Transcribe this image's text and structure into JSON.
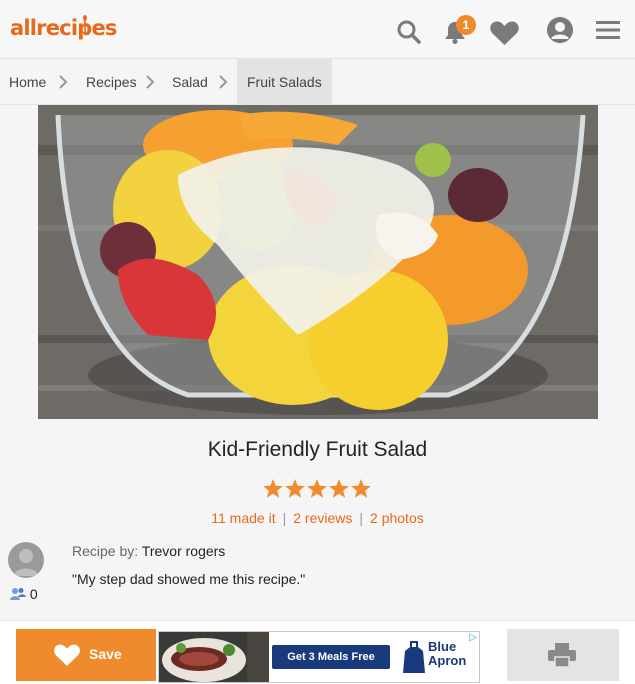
{
  "header": {
    "logo_text": "allrecipes",
    "notification_count": "1",
    "icons": [
      "search-icon",
      "bell-icon",
      "heart-icon",
      "profile-icon",
      "menu-icon"
    ],
    "brand_color": "#e8691c"
  },
  "breadcrumb": {
    "items": [
      {
        "label": "Home"
      },
      {
        "label": "Recipes"
      },
      {
        "label": "Salad"
      },
      {
        "label": "Fruit Salads"
      }
    ]
  },
  "recipe": {
    "title": "Kid-Friendly Fruit Salad",
    "rating": 5,
    "rating_max": 5,
    "made_it": "11 made it",
    "reviews": "2 reviews",
    "photos": "2 photos",
    "separator": "|",
    "author_label": "Recipe by:",
    "author_name": "Trevor rogers",
    "description": "\"My step dad showed me this recipe.\"",
    "followers": "0"
  },
  "footer": {
    "save_label": "Save",
    "ad": {
      "cta": "Get 3 Meals Free",
      "brand_line1": "Blue",
      "brand_line2": "Apron",
      "ad_choices": "▷"
    }
  },
  "colors": {
    "accent": "#f08b2d",
    "star": "#f08b2d",
    "ad_blue": "#1a3a7e"
  }
}
